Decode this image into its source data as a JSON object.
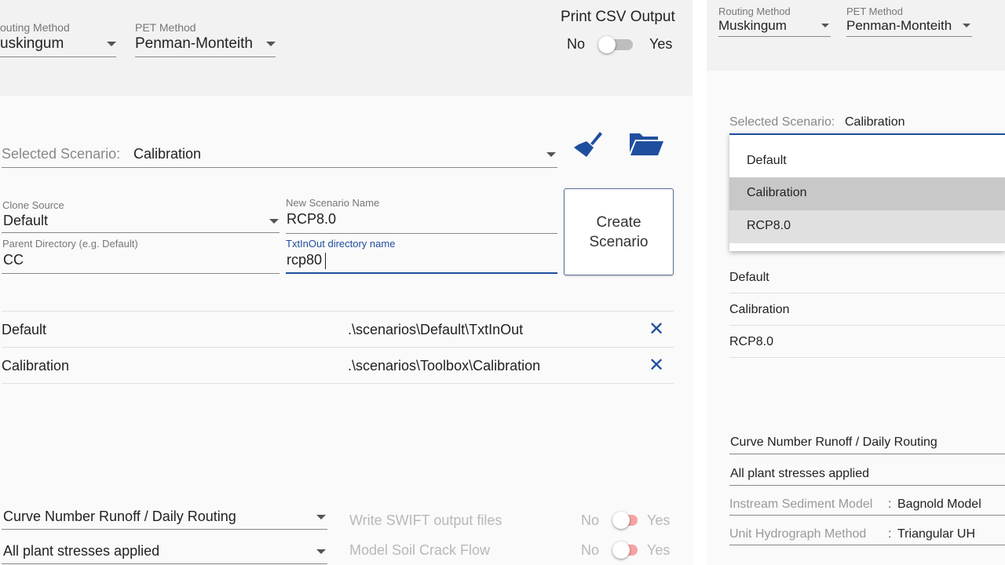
{
  "left": {
    "routing": {
      "label": "outing Method",
      "value": "uskingum"
    },
    "pet": {
      "label": "PET Method",
      "value": "Penman-Monteith"
    },
    "csv": {
      "label": "Print CSV Output",
      "no": "No",
      "yes": "Yes"
    },
    "scenario": {
      "label": "Selected Scenario:",
      "value": "Calibration"
    },
    "clone_source": {
      "label": "Clone Source",
      "value": "Default"
    },
    "new_name": {
      "label": "New Scenario Name",
      "value": "RCP8.0"
    },
    "parent_dir": {
      "label": "Parent Directory (e.g. Default)",
      "value": "CC"
    },
    "txtinout": {
      "label": "TxtInOut directory name",
      "value": "rcp80"
    },
    "create_button": {
      "line1": "Create",
      "line2": "Scenario"
    },
    "scenario_list": [
      {
        "name": "Default",
        "path": ".\\scenarios\\Default\\TxtInOut"
      },
      {
        "name": "Calibration",
        "path": ".\\scenarios\\Toolbox\\Calibration"
      }
    ],
    "runoff": {
      "value": "Curve Number Runoff / Daily Routing"
    },
    "stress": {
      "value": "All plant stresses applied"
    },
    "swift": {
      "label": "Write SWIFT output files",
      "no": "No",
      "yes": "Yes"
    },
    "crack": {
      "label": "Model Soil Crack Flow",
      "no": "No",
      "yes": "Yes"
    }
  },
  "right": {
    "routing": {
      "label": "Routing Method",
      "value": "Muskingum"
    },
    "pet": {
      "label": "PET Method",
      "value": "Penman-Monteith"
    },
    "scenario": {
      "label": "Selected Scenario:",
      "value": "Calibration"
    },
    "dropdown_options": [
      "Default",
      "Calibration",
      "RCP8.0"
    ],
    "list": [
      "Default",
      "Calibration",
      "RCP8.0"
    ],
    "runoff": "Curve Number Runoff / Daily Routing",
    "stress": "All plant stresses applied",
    "sediment": {
      "label": "Instream Sediment Model",
      "value": "Bagnold Model"
    },
    "hydrograph": {
      "label": "Unit Hydrograph Method",
      "value": "Triangular UH"
    }
  },
  "colors": {
    "accent": "#1f4e9e",
    "toggle_off": "#bdbdbd",
    "toggle_pink": "#f5a3a3",
    "selected": "#c8c8c8",
    "hover": "#e0e0e0"
  }
}
